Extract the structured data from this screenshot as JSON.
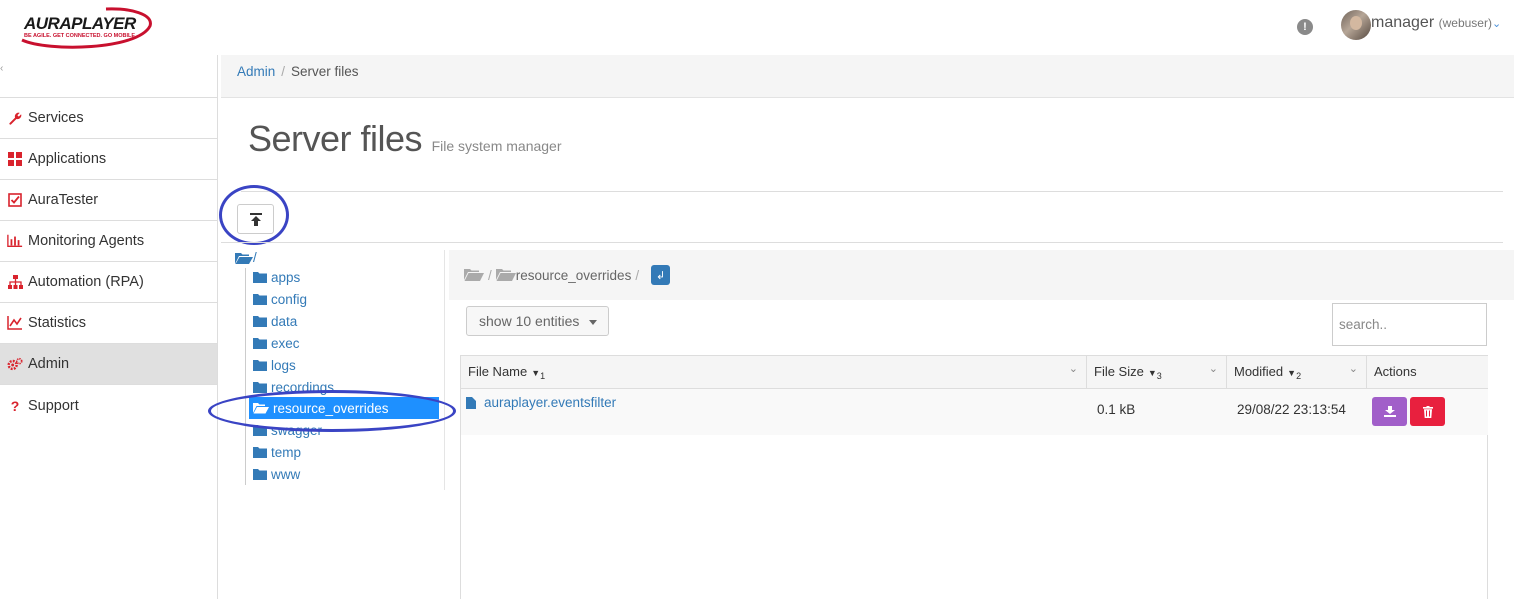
{
  "header": {
    "logo_text": "AURAPLAYER",
    "logo_tagline": "BE AGILE. GET CONNECTED. GO MOBILE",
    "alert_glyph": "!",
    "user_name": "manager",
    "user_role": "(webuser)",
    "user_chevron": "⌄"
  },
  "sidebar": {
    "toggle": "‹",
    "items": [
      {
        "label": "Services",
        "icon": "wrench-icon",
        "glyph": "🔧"
      },
      {
        "label": "Applications",
        "icon": "grid-icon",
        "glyph": "▦"
      },
      {
        "label": "AuraTester",
        "icon": "checkbox-icon",
        "glyph": "☑"
      },
      {
        "label": "Monitoring Agents",
        "icon": "bar-chart-icon",
        "glyph": "▥"
      },
      {
        "label": "Automation (RPA)",
        "icon": "sitemap-icon",
        "glyph": "⊞"
      },
      {
        "label": "Statistics",
        "icon": "line-chart-icon",
        "glyph": "⟋"
      },
      {
        "label": "Admin",
        "icon": "cogs-icon",
        "glyph": "⚙"
      },
      {
        "label": "Support",
        "icon": "question-icon",
        "glyph": "?"
      }
    ],
    "active": "Admin",
    "accent_color": "#d9232d"
  },
  "breadcrumb": {
    "parent": "Admin",
    "separator": "/",
    "current": "Server files"
  },
  "page": {
    "title": "Server files",
    "subtitle": "File system manager"
  },
  "tree": {
    "root": "/",
    "folders": [
      "apps",
      "config",
      "data",
      "exec",
      "logs",
      "recordings",
      "resource_overrides",
      "swagger",
      "temp",
      "www"
    ],
    "selected": "resource_overrides"
  },
  "path_bar": {
    "segments": [
      "resource_overrides"
    ],
    "separator": "/",
    "up_glyph": "↲"
  },
  "table_controls": {
    "length_label": "show 10 entities",
    "search_placeholder": "search.."
  },
  "table": {
    "columns": [
      {
        "label": "File Name",
        "sort_order": "1"
      },
      {
        "label": "File Size",
        "sort_order": "3"
      },
      {
        "label": "Modified",
        "sort_order": "2"
      },
      {
        "label": "Actions",
        "sort_order": ""
      }
    ],
    "rows": [
      {
        "name": "auraplayer.eventsfilter",
        "size": "0.1 kB",
        "modified": "29/08/22 23:13:54"
      }
    ]
  },
  "colors": {
    "link": "#337ab7",
    "selected_folder": "#1e90ff",
    "download_button": "#a15fc9",
    "delete_button": "#e8203e",
    "annotation_circle": "#3a44c4"
  }
}
